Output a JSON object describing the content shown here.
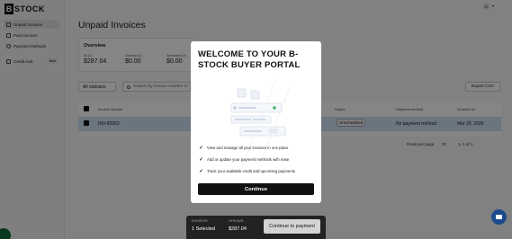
{
  "brand": {
    "b": "B",
    "stock": "STOCK"
  },
  "sidebar": {
    "items": [
      {
        "label": "Unpaid Invoices",
        "active": true
      },
      {
        "label": "Paid Invoices",
        "active": false
      },
      {
        "label": "Payment Methods",
        "active": false
      },
      {
        "label": "Credit Hub",
        "badge": "Beta",
        "active": false
      }
    ]
  },
  "topbar": {
    "avatar": "H",
    "caret": "▾"
  },
  "page": {
    "title": "Unpaid Invoices"
  },
  "overview": {
    "title": "Overview",
    "items": [
      {
        "label": "All (1)",
        "value": "$287.04"
      },
      {
        "label": "Overdue (0)",
        "value": "$0.00"
      },
      {
        "label": "Scheduled (0)",
        "value": "$0.00"
      }
    ]
  },
  "filters": {
    "status": "All statuses",
    "search_placeholder": "Search by invoice number or",
    "export_label": "Export CSV"
  },
  "table": {
    "columns": [
      "Invoice number",
      "Status",
      "Payment method",
      "Invoiced on"
    ],
    "rows": [
      {
        "invoice": "INV-82953",
        "status": "Unscheduled",
        "payment_method": "No payment method",
        "invoiced_on": "Mar 20, 2026"
      }
    ]
  },
  "pagination": {
    "rows_label": "Rows per page:",
    "rows_value": "20",
    "range": "1–1 of 1"
  },
  "modal": {
    "title": "WELCOME TO YOUR B-STOCK BUYER PORTAL",
    "features": [
      "View and manage all your invoices in one place",
      "Add or update your payment methods with ease",
      "Track your available credit and upcoming payments"
    ],
    "continue_label": "Continue"
  },
  "paybar": {
    "invoices_label": "Invoices",
    "invoices_value": "1 Selected",
    "amount_label": "Amount",
    "amount_value": "$287.04",
    "pay_label": "Continue to payment"
  },
  "colors": {
    "brand": "#111111",
    "row_highlight": "#cde0f3",
    "chat": "#1e4a8c",
    "success": "#0e6b37"
  }
}
